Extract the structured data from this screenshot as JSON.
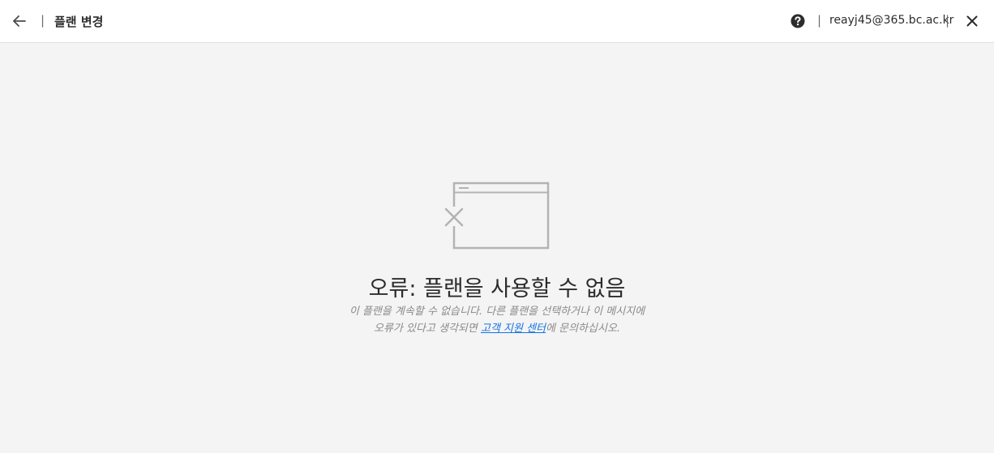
{
  "header": {
    "title": "플랜 변경",
    "separator": "|",
    "email": "reayj45@365.bc.ac.kr"
  },
  "error": {
    "title": "오류: 플랜을 사용할 수 없음",
    "desc_before": "이 플랜을 계속할 수 없습니다. 다른 플랜을 선택하거나 이 메시지에 오류가 있다고 생각되면 ",
    "link_text": "고객 지원 센터",
    "desc_after": "에 문의하십시오."
  },
  "icons": {
    "back": "arrow-left-icon",
    "help": "help-circle-icon",
    "close": "close-icon",
    "illustration": "browser-window-error-icon"
  },
  "colors": {
    "background": "#f4f4f4",
    "header_bg": "#ffffff",
    "text": "#2c2c2c",
    "muted": "#8a8a8a",
    "link": "#1473e6",
    "illustration": "#b3b3b3"
  }
}
